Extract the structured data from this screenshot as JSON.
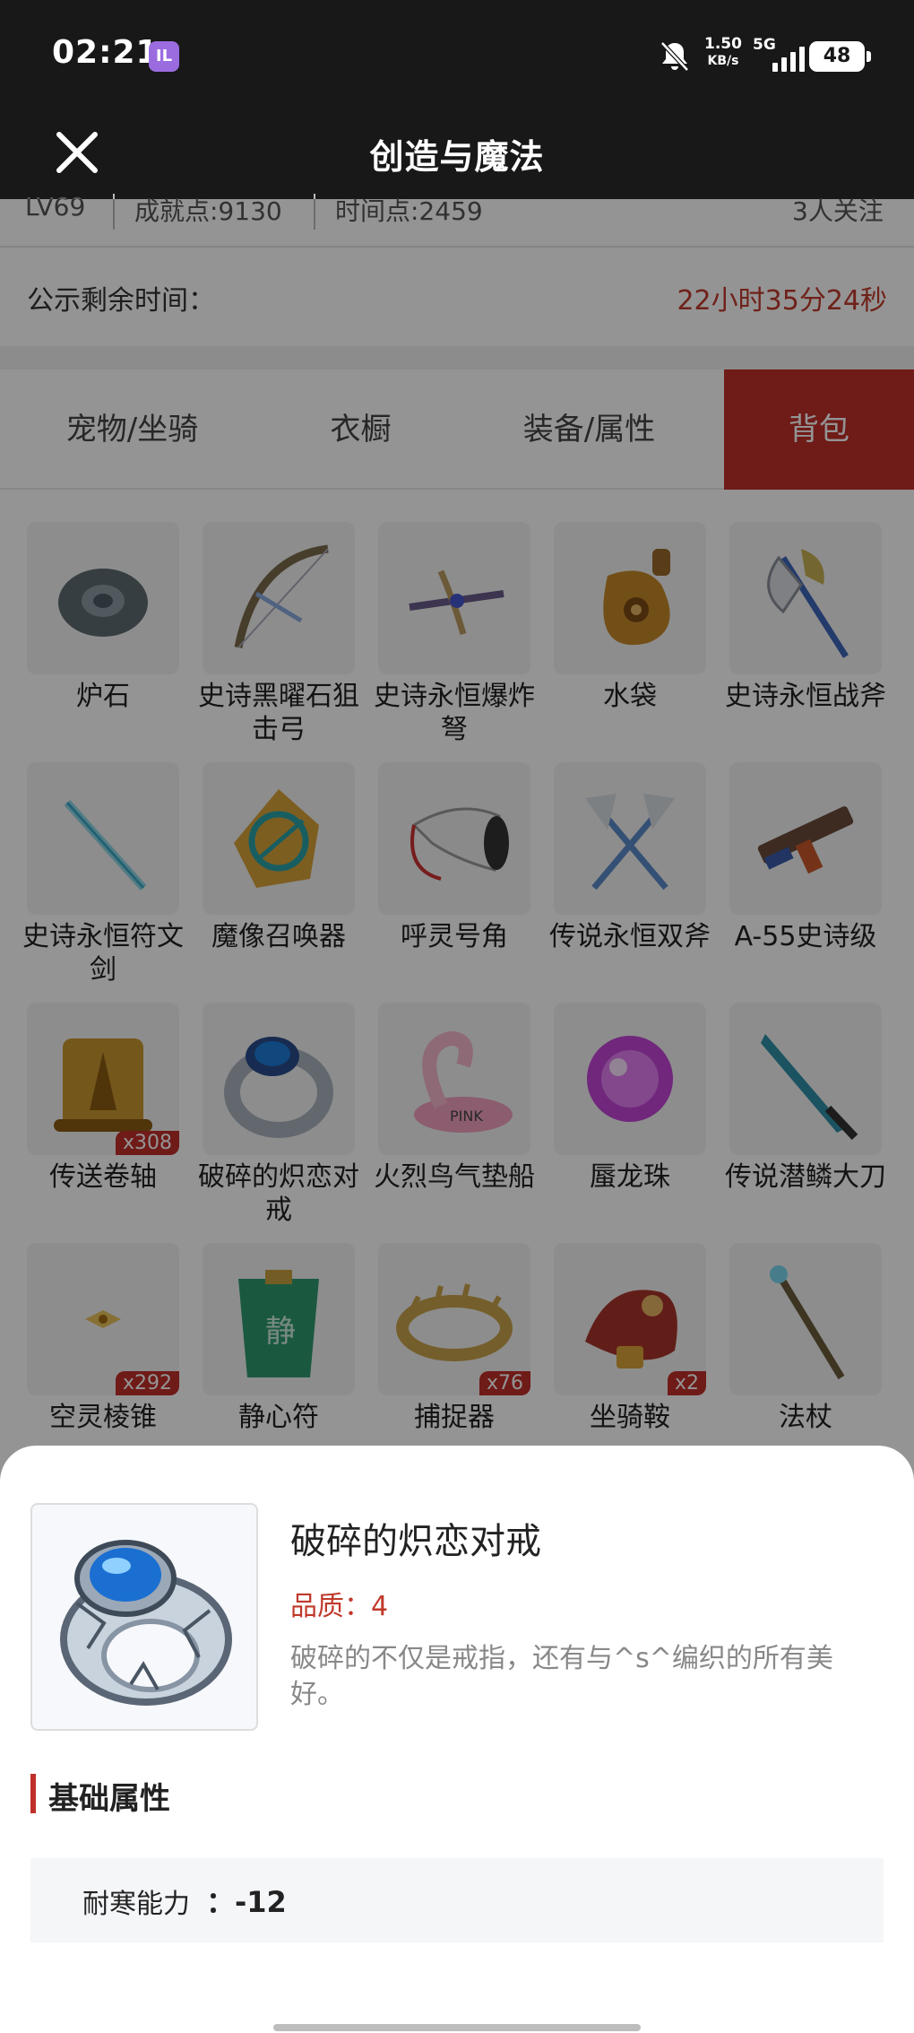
{
  "status_bar": {
    "time": "02:21",
    "app_badge": "IL",
    "speed_value": "1.50",
    "speed_unit": "KB/s",
    "network": "5G",
    "battery": "48"
  },
  "header": {
    "title": "创造与魔法"
  },
  "stats": {
    "level": "LV69",
    "achievement": "成就点:9130",
    "time_points": "时间点:2459",
    "followers": "3人关注"
  },
  "publicity": {
    "label": "公示剩余时间：",
    "countdown": "22小时35分24秒"
  },
  "tabs": [
    "宠物/坐骑",
    "衣橱",
    "装备/属性",
    "背包"
  ],
  "active_tab": "背包",
  "inventory": [
    {
      "name": "炉石",
      "icon": "hearthstone-icon"
    },
    {
      "name": "史诗黑曜石狙击弓",
      "icon": "bow-icon"
    },
    {
      "name": "史诗永恒爆炸弩",
      "icon": "crossbow-icon"
    },
    {
      "name": "水袋",
      "icon": "waterskin-icon"
    },
    {
      "name": "史诗永恒战斧",
      "icon": "battle-axe-icon"
    },
    {
      "name": "史诗永恒符文剑",
      "icon": "rune-sword-icon"
    },
    {
      "name": "魔像召唤器",
      "icon": "golem-summoner-icon"
    },
    {
      "name": "呼灵号角",
      "icon": "horn-icon"
    },
    {
      "name": "传说永恒双斧",
      "icon": "double-axe-icon"
    },
    {
      "name": "A-55史诗级",
      "icon": "rifle-icon"
    },
    {
      "name": "传送卷轴",
      "icon": "scroll-icon",
      "count": "x308"
    },
    {
      "name": "破碎的炽恋对戒",
      "icon": "ring-icon"
    },
    {
      "name": "火烈鸟气垫船",
      "icon": "flamingo-float-icon"
    },
    {
      "name": "蜃龙珠",
      "icon": "purple-orb-icon"
    },
    {
      "name": "传说潜鳞大刀",
      "icon": "blade-icon"
    },
    {
      "name": "空灵棱锥",
      "icon": "prism-icon",
      "count": "x292"
    },
    {
      "name": "静心符",
      "icon": "talisman-icon"
    },
    {
      "name": "捕捉器",
      "icon": "trap-icon",
      "count": "x76"
    },
    {
      "name": "坐骑鞍",
      "icon": "saddle-icon",
      "count": "x2"
    },
    {
      "name": "法杖",
      "icon": "staff-icon"
    }
  ],
  "detail": {
    "name": "破碎的炽恋对戒",
    "quality": "品质：4",
    "description": "破碎的不仅是戒指，还有与^s^编织的所有美好。",
    "section_title": "基础属性",
    "attribute_name": "耐寒能力",
    "attribute_value": "：-12"
  },
  "colors": {
    "accent": "#c0302a",
    "header_bg": "#181818",
    "countdown": "#c0392b"
  }
}
